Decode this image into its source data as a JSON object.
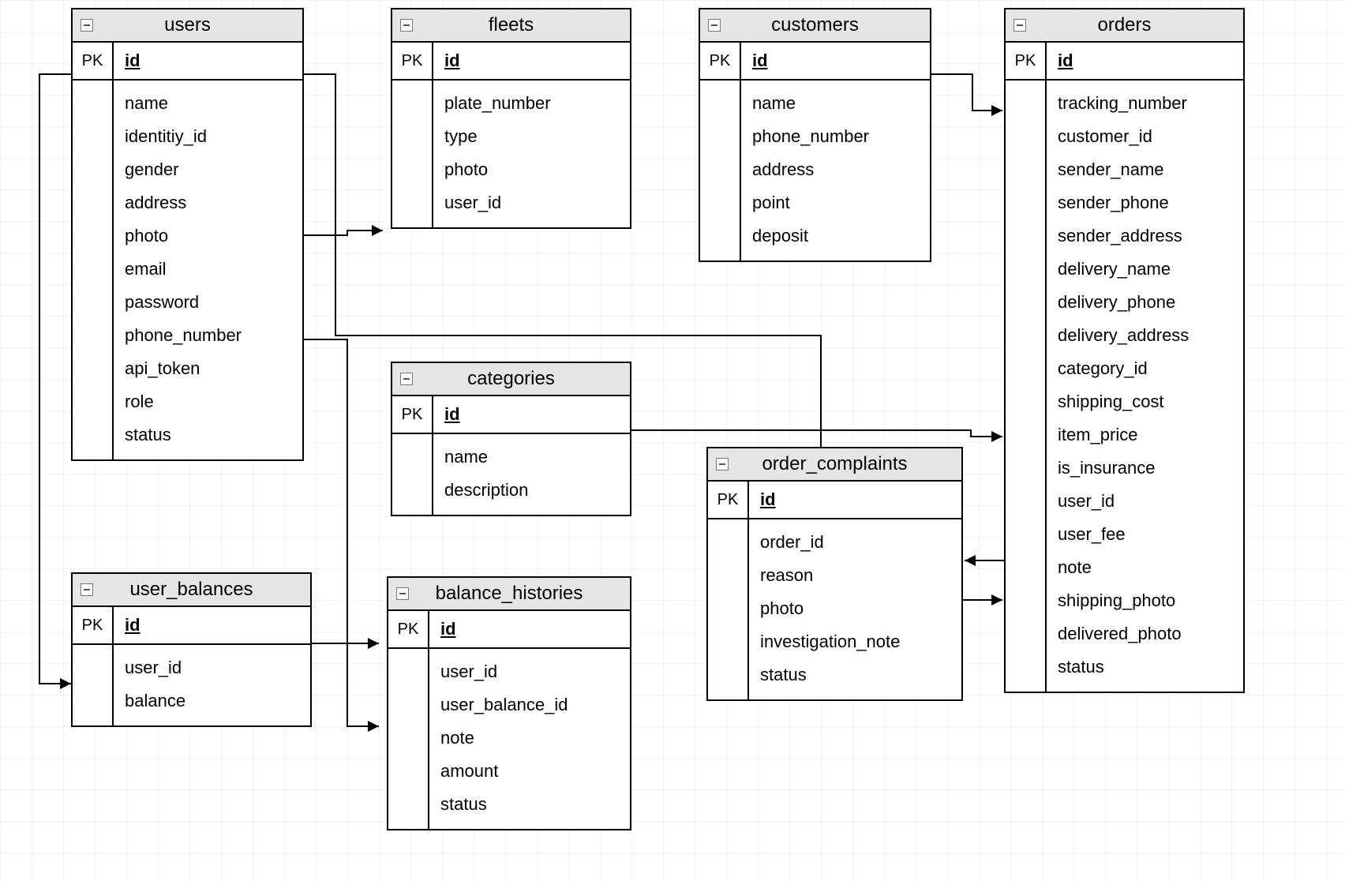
{
  "pk_label": "PK",
  "pk_id": "id",
  "entities": {
    "users": {
      "title": "users",
      "attrs": [
        "name",
        "identitiy_id",
        "gender",
        "address",
        "photo",
        "email",
        "password",
        "phone_number",
        "api_token",
        "role",
        "status"
      ]
    },
    "fleets": {
      "title": "fleets",
      "attrs": [
        "plate_number",
        "type",
        "photo",
        "user_id"
      ]
    },
    "customers": {
      "title": "customers",
      "attrs": [
        "name",
        "phone_number",
        "address",
        "point",
        "deposit"
      ]
    },
    "orders": {
      "title": "orders",
      "attrs": [
        "tracking_number",
        "customer_id",
        "sender_name",
        "sender_phone",
        "sender_address",
        "delivery_name",
        "delivery_phone",
        "delivery_address",
        "category_id",
        "shipping_cost",
        "item_price",
        "is_insurance",
        "user_id",
        "user_fee",
        "note",
        "shipping_photo",
        "delivered_photo",
        "status"
      ]
    },
    "user_balances": {
      "title": "user_balances",
      "attrs": [
        "user_id",
        "balance"
      ]
    },
    "categories": {
      "title": "categories",
      "attrs": [
        "name",
        "description"
      ]
    },
    "balance_histories": {
      "title": "balance_histories",
      "attrs": [
        "user_id",
        "user_balance_id",
        "note",
        "amount",
        "status"
      ]
    },
    "order_complaints": {
      "title": "order_complaints",
      "attrs": [
        "order_id",
        "reason",
        "photo",
        "investigation_note",
        "status"
      ]
    }
  },
  "relationships": [
    {
      "from": "users",
      "to": "fleets"
    },
    {
      "from": "users",
      "to": "balance_histories"
    },
    {
      "from": "users",
      "to": "user_balances"
    },
    {
      "from": "users",
      "to": "orders"
    },
    {
      "from": "user_balances",
      "to": "balance_histories"
    },
    {
      "from": "categories",
      "to": "orders"
    },
    {
      "from": "customers",
      "to": "orders"
    },
    {
      "from": "orders",
      "to": "order_complaints"
    }
  ]
}
